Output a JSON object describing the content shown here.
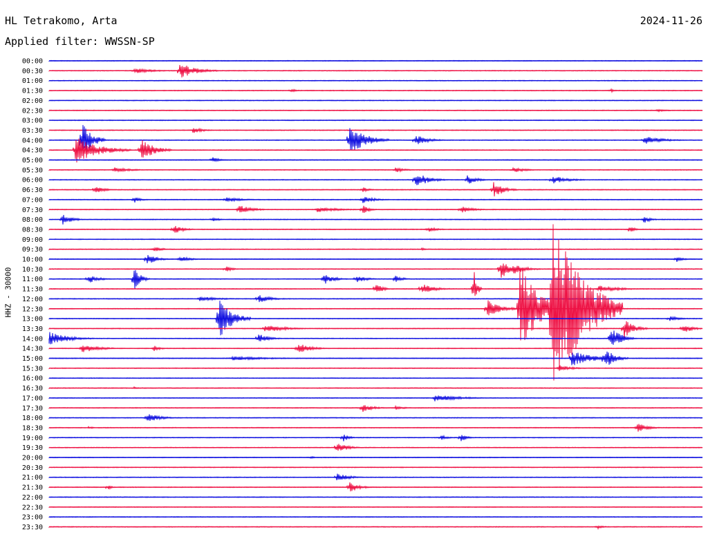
{
  "header": {
    "station": "HL Tetrakomo, Arta",
    "date": "2024-11-26",
    "filter": "Applied filter: WWSSN-SP",
    "channel": "HHZ - 30000"
  },
  "colors": {
    "blue": "#1010e0",
    "red": "#ee1144"
  },
  "traces": [
    {
      "time": "00:00",
      "color": "blue",
      "events": []
    },
    {
      "time": "00:30",
      "color": "red",
      "events": [
        {
          "at": 0.13,
          "amp": 4,
          "len": 0.06
        },
        {
          "at": 0.2,
          "amp": 12,
          "len": 0.05
        }
      ]
    },
    {
      "time": "01:00",
      "color": "blue",
      "events": []
    },
    {
      "time": "01:30",
      "color": "red",
      "events": [
        {
          "at": 0.37,
          "amp": 3,
          "len": 0.02
        },
        {
          "at": 0.86,
          "amp": 3,
          "len": 0.01
        }
      ]
    },
    {
      "time": "02:00",
      "color": "blue",
      "events": []
    },
    {
      "time": "02:30",
      "color": "red",
      "events": [
        {
          "at": 0.93,
          "amp": 2,
          "len": 0.04
        }
      ]
    },
    {
      "time": "03:00",
      "color": "blue",
      "events": []
    },
    {
      "time": "03:30",
      "color": "red",
      "events": [
        {
          "at": 0.22,
          "amp": 5,
          "len": 0.03
        }
      ]
    },
    {
      "time": "04:00",
      "color": "blue",
      "events": [
        {
          "at": 0.05,
          "amp": 30,
          "len": 0.03
        },
        {
          "at": 0.46,
          "amp": 22,
          "len": 0.05
        },
        {
          "at": 0.56,
          "amp": 8,
          "len": 0.04
        },
        {
          "at": 0.91,
          "amp": 6,
          "len": 0.06
        }
      ]
    },
    {
      "time": "04:30",
      "color": "red",
      "events": [
        {
          "at": 0.04,
          "amp": 20,
          "len": 0.07
        },
        {
          "at": 0.14,
          "amp": 18,
          "len": 0.04
        }
      ]
    },
    {
      "time": "05:00",
      "color": "blue",
      "events": [
        {
          "at": 0.25,
          "amp": 5,
          "len": 0.02
        }
      ]
    },
    {
      "time": "05:30",
      "color": "red",
      "events": [
        {
          "at": 0.1,
          "amp": 4,
          "len": 0.05
        },
        {
          "at": 0.53,
          "amp": 4,
          "len": 0.03
        },
        {
          "at": 0.71,
          "amp": 4,
          "len": 0.04
        }
      ]
    },
    {
      "time": "06:00",
      "color": "blue",
      "events": [
        {
          "at": 0.56,
          "amp": 12,
          "len": 0.04
        },
        {
          "at": 0.64,
          "amp": 7,
          "len": 0.03
        },
        {
          "at": 0.77,
          "amp": 6,
          "len": 0.05
        }
      ]
    },
    {
      "time": "06:30",
      "color": "red",
      "events": [
        {
          "at": 0.07,
          "amp": 6,
          "len": 0.03
        },
        {
          "at": 0.48,
          "amp": 4,
          "len": 0.02
        },
        {
          "at": 0.68,
          "amp": 13,
          "len": 0.03
        }
      ]
    },
    {
      "time": "07:00",
      "color": "blue",
      "events": [
        {
          "at": 0.13,
          "amp": 5,
          "len": 0.02
        },
        {
          "at": 0.27,
          "amp": 4,
          "len": 0.05
        },
        {
          "at": 0.48,
          "amp": 5,
          "len": 0.04
        }
      ]
    },
    {
      "time": "07:30",
      "color": "red",
      "events": [
        {
          "at": 0.29,
          "amp": 7,
          "len": 0.04
        },
        {
          "at": 0.41,
          "amp": 4,
          "len": 0.07
        },
        {
          "at": 0.48,
          "amp": 8,
          "len": 0.02
        },
        {
          "at": 0.63,
          "amp": 5,
          "len": 0.04
        }
      ]
    },
    {
      "time": "08:00",
      "color": "blue",
      "events": [
        {
          "at": 0.02,
          "amp": 8,
          "len": 0.03
        },
        {
          "at": 0.25,
          "amp": 4,
          "len": 0.02
        },
        {
          "at": 0.91,
          "amp": 6,
          "len": 0.02
        }
      ]
    },
    {
      "time": "08:30",
      "color": "red",
      "events": [
        {
          "at": 0.19,
          "amp": 7,
          "len": 0.03
        },
        {
          "at": 0.58,
          "amp": 4,
          "len": 0.03
        },
        {
          "at": 0.89,
          "amp": 10,
          "len": 0.01
        }
      ]
    },
    {
      "time": "09:00",
      "color": "blue",
      "events": []
    },
    {
      "time": "09:30",
      "color": "red",
      "events": [
        {
          "at": 0.16,
          "amp": 4,
          "len": 0.03
        },
        {
          "at": 0.57,
          "amp": 2,
          "len": 0.02
        }
      ]
    },
    {
      "time": "10:00",
      "color": "blue",
      "events": [
        {
          "at": 0.15,
          "amp": 8,
          "len": 0.03
        },
        {
          "at": 0.2,
          "amp": 5,
          "len": 0.03
        },
        {
          "at": 0.96,
          "amp": 5,
          "len": 0.02
        }
      ]
    },
    {
      "time": "10:30",
      "color": "red",
      "events": [
        {
          "at": 0.27,
          "amp": 5,
          "len": 0.02
        },
        {
          "at": 0.69,
          "amp": 16,
          "len": 0.03
        },
        {
          "at": 0.71,
          "amp": 8,
          "len": 0.04
        }
      ]
    },
    {
      "time": "11:00",
      "color": "blue",
      "events": [
        {
          "at": 0.06,
          "amp": 7,
          "len": 0.03
        },
        {
          "at": 0.13,
          "amp": 18,
          "len": 0.02
        },
        {
          "at": 0.42,
          "amp": 9,
          "len": 0.03
        },
        {
          "at": 0.47,
          "amp": 6,
          "len": 0.03
        },
        {
          "at": 0.53,
          "amp": 7,
          "len": 0.02
        }
      ]
    },
    {
      "time": "11:30",
      "color": "red",
      "events": [
        {
          "at": 0.5,
          "amp": 9,
          "len": 0.02
        },
        {
          "at": 0.57,
          "amp": 8,
          "len": 0.04
        },
        {
          "at": 0.65,
          "amp": 30,
          "len": 0.01
        },
        {
          "at": 0.84,
          "amp": 5,
          "len": 0.07
        }
      ]
    },
    {
      "time": "12:00",
      "color": "blue",
      "events": [
        {
          "at": 0.23,
          "amp": 4,
          "len": 0.06
        },
        {
          "at": 0.32,
          "amp": 6,
          "len": 0.04
        }
      ]
    },
    {
      "time": "12:30",
      "color": "red",
      "events": [
        {
          "at": 0.67,
          "amp": 14,
          "len": 0.04
        },
        {
          "at": 0.72,
          "amp": 70,
          "len": 0.06
        },
        {
          "at": 0.77,
          "amp": 140,
          "len": 0.09
        }
      ]
    },
    {
      "time": "13:00",
      "color": "blue",
      "events": [
        {
          "at": 0.26,
          "amp": 30,
          "len": 0.04
        },
        {
          "at": 0.95,
          "amp": 4,
          "len": 0.03
        }
      ]
    },
    {
      "time": "13:30",
      "color": "red",
      "events": [
        {
          "at": 0.33,
          "amp": 6,
          "len": 0.06
        },
        {
          "at": 0.88,
          "amp": 15,
          "len": 0.03
        },
        {
          "at": 0.97,
          "amp": 7,
          "len": 0.03
        }
      ]
    },
    {
      "time": "14:00",
      "color": "blue",
      "events": [
        {
          "at": 0.0,
          "amp": 10,
          "len": 0.06
        },
        {
          "at": 0.32,
          "amp": 8,
          "len": 0.03
        },
        {
          "at": 0.86,
          "amp": 18,
          "len": 0.03
        }
      ]
    },
    {
      "time": "14:30",
      "color": "red",
      "events": [
        {
          "at": 0.05,
          "amp": 8,
          "len": 0.05
        },
        {
          "at": 0.16,
          "amp": 5,
          "len": 0.02
        },
        {
          "at": 0.38,
          "amp": 9,
          "len": 0.04
        }
      ]
    },
    {
      "time": "15:00",
      "color": "blue",
      "events": [
        {
          "at": 0.28,
          "amp": 3,
          "len": 0.12
        },
        {
          "at": 0.8,
          "amp": 12,
          "len": 0.06
        },
        {
          "at": 0.85,
          "amp": 16,
          "len": 0.03
        }
      ]
    },
    {
      "time": "15:30",
      "color": "red",
      "events": [
        {
          "at": 0.78,
          "amp": 5,
          "len": 0.04
        }
      ]
    },
    {
      "time": "16:00",
      "color": "blue",
      "events": []
    },
    {
      "time": "16:30",
      "color": "red",
      "events": [
        {
          "at": 0.13,
          "amp": 2,
          "len": 0.02
        }
      ]
    },
    {
      "time": "17:00",
      "color": "blue",
      "events": [
        {
          "at": 0.59,
          "amp": 5,
          "len": 0.08
        }
      ]
    },
    {
      "time": "17:30",
      "color": "red",
      "events": [
        {
          "at": 0.48,
          "amp": 7,
          "len": 0.03
        },
        {
          "at": 0.53,
          "amp": 3,
          "len": 0.03
        }
      ]
    },
    {
      "time": "18:00",
      "color": "blue",
      "events": [
        {
          "at": 0.15,
          "amp": 7,
          "len": 0.04
        }
      ]
    },
    {
      "time": "18:30",
      "color": "red",
      "events": [
        {
          "at": 0.06,
          "amp": 2,
          "len": 0.02
        },
        {
          "at": 0.9,
          "amp": 8,
          "len": 0.03
        }
      ]
    },
    {
      "time": "19:00",
      "color": "blue",
      "events": [
        {
          "at": 0.45,
          "amp": 6,
          "len": 0.02
        },
        {
          "at": 0.6,
          "amp": 4,
          "len": 0.02
        },
        {
          "at": 0.63,
          "amp": 6,
          "len": 0.02
        }
      ]
    },
    {
      "time": "19:30",
      "color": "red",
      "events": [
        {
          "at": 0.44,
          "amp": 9,
          "len": 0.03
        }
      ]
    },
    {
      "time": "20:00",
      "color": "blue",
      "events": [
        {
          "at": 0.4,
          "amp": 2,
          "len": 0.02
        }
      ]
    },
    {
      "time": "20:30",
      "color": "red",
      "events": []
    },
    {
      "time": "21:00",
      "color": "blue",
      "events": [
        {
          "at": 0.44,
          "amp": 6,
          "len": 0.04
        }
      ]
    },
    {
      "time": "21:30",
      "color": "red",
      "events": [
        {
          "at": 0.09,
          "amp": 6,
          "len": 0.01
        },
        {
          "at": 0.46,
          "amp": 8,
          "len": 0.03
        }
      ]
    },
    {
      "time": "22:00",
      "color": "blue",
      "events": []
    },
    {
      "time": "22:30",
      "color": "red",
      "events": []
    },
    {
      "time": "23:00",
      "color": "blue",
      "events": []
    },
    {
      "time": "23:30",
      "color": "red",
      "events": [
        {
          "at": 0.84,
          "amp": 3,
          "len": 0.02
        }
      ]
    }
  ]
}
